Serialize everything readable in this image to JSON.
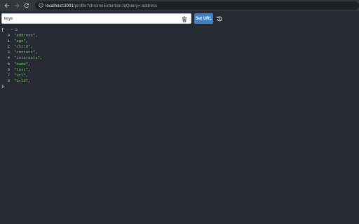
{
  "browser": {
    "back_icon": "arrow-left-icon",
    "forward_icon": "arrow-right-icon",
    "reload_icon": "reload-icon",
    "site_info_icon": "site-info-icon",
    "url_host": "localhost:3001",
    "url_path": "/profile?chromeExtentionJqQuery=.address"
  },
  "toolbar": {
    "query_value": "keys",
    "clear_icon": "trash-icon",
    "set_url_label": "Set URL",
    "history_icon": "history-icon"
  },
  "result": {
    "open_bracket": "[",
    "close_bracket": "]",
    "collapse_hints": "- + ⧉",
    "items": [
      {
        "index": "0",
        "value": "\"address\"",
        "comma": ","
      },
      {
        "index": "1",
        "value": "\"age\"",
        "comma": ","
      },
      {
        "index": "2",
        "value": "\"child\"",
        "comma": ","
      },
      {
        "index": "3",
        "value": "\"contact\"",
        "comma": ","
      },
      {
        "index": "4",
        "value": "\"interests\"",
        "comma": ","
      },
      {
        "index": "5",
        "value": "\"name\"",
        "comma": ","
      },
      {
        "index": "6",
        "value": "\"test\"",
        "comma": ","
      },
      {
        "index": "7",
        "value": "\"url\"",
        "comma": ","
      },
      {
        "index": "8",
        "value": "\"url2\"",
        "comma": ","
      }
    ]
  },
  "colors": {
    "background": "#262a33",
    "accent": "#3c82c4",
    "string_value": "#7cc06a"
  }
}
